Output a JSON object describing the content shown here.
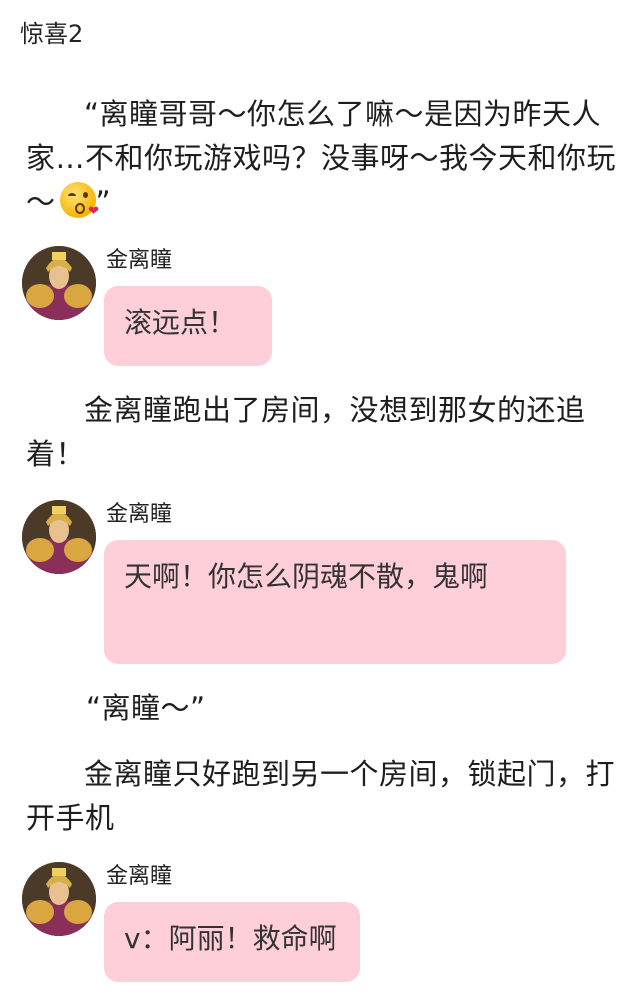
{
  "title": "惊喜2",
  "paragraphs": [
    "“离瞳哥哥～你怎么了嘛～是因为昨天人家…不和你玩游戏吗？没事呀～我今天和你玩～",
    "金离瞳跑出了房间，没想到那女的还追着！",
    "“离瞳～”",
    "金离瞳只好跑到另一个房间，锁起门，打开手机"
  ],
  "paragraph_1_close_quote": "”",
  "emoji": "kissing-face-heart-icon",
  "chats": [
    {
      "name": "金离瞳",
      "message": "滚远点！"
    },
    {
      "name": "金离瞳",
      "message": "天啊！你怎么阴魂不散，鬼啊"
    },
    {
      "name": "金离瞳",
      "message": "v：阿丽！救命啊"
    }
  ],
  "colors": {
    "bubble": "#ffcfd9",
    "text": "#222222",
    "background": "#ffffff"
  }
}
